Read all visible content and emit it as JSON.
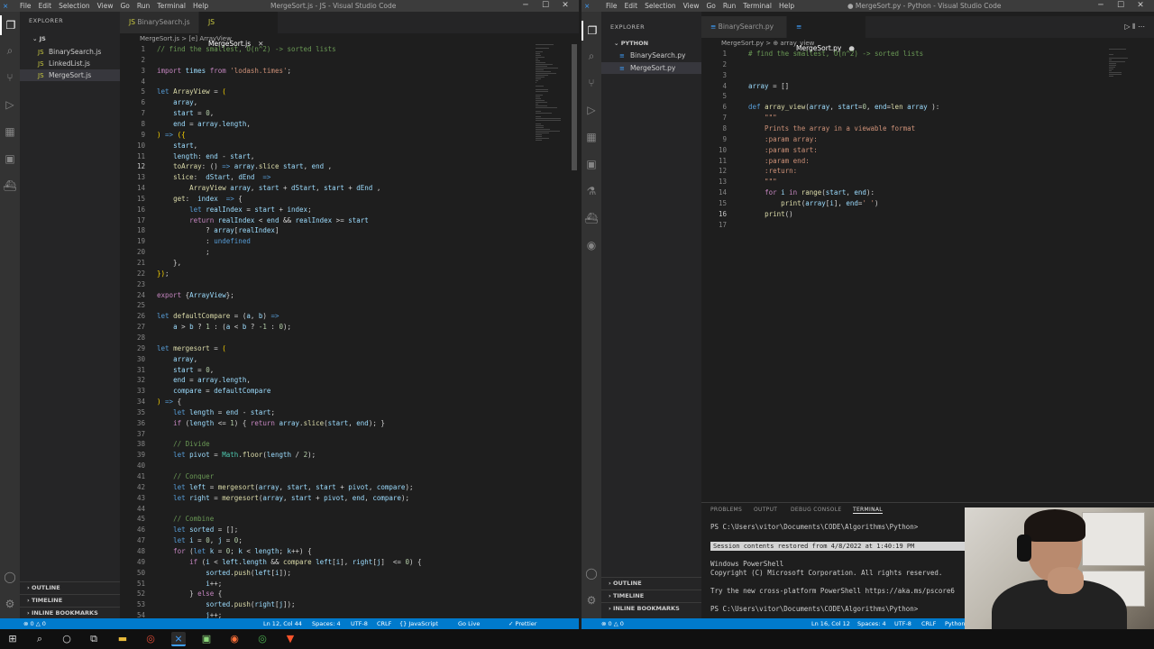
{
  "left": {
    "title": "MergeSort.js - JS - Visual Studio Code",
    "menu": [
      "File",
      "Edit",
      "Selection",
      "View",
      "Go",
      "Run",
      "Terminal",
      "Help"
    ],
    "explorer_label": "EXPLORER",
    "folder": "JS",
    "files": [
      "BinarySearch.js",
      "LinkedList.js",
      "MergeSort.js"
    ],
    "tabs": [
      "BinarySearch.js",
      "MergeSort.js"
    ],
    "breadcrumb": "MergeSort.js > [e] ArrayView",
    "panels": [
      "OUTLINE",
      "TIMELINE",
      "INLINE BOOKMARKS"
    ],
    "status": {
      "errors": "⊗ 0 △ 0",
      "position": "Ln 12, Col 44",
      "spaces": "Spaces: 4",
      "encoding": "UTF-8",
      "eol": "CRLF",
      "language": "{} JavaScript",
      "golive": "Go Live",
      "prettier": "✓ Prettier"
    },
    "lines": [
      {
        "n": "1",
        "h": "<span class='cm'>// find the smallest, O(n^2) -> sorted lists</span>"
      },
      {
        "n": "2",
        "h": ""
      },
      {
        "n": "3",
        "h": "<span class='kw2'>import</span> <span class='vr'>times</span> <span class='kw2'>from</span> <span class='st'>'lodash.times'</span>;"
      },
      {
        "n": "4",
        "h": ""
      },
      {
        "n": "5",
        "h": "<span class='kw'>let</span> <span class='fn'>ArrayView</span> = <span class='br'>(</span>"
      },
      {
        "n": "6",
        "h": "    <span class='vr'>array</span>,"
      },
      {
        "n": "7",
        "h": "    <span class='vr'>start</span> = <span class='nu'>0</span>,"
      },
      {
        "n": "8",
        "h": "    <span class='vr'>end</span> = <span class='vr'>array</span>.<span class='vr'>length</span>,"
      },
      {
        "n": "9",
        "h": "<span class='br'>)</span> <span class='kw'>=></span> <span class='br'>({</span>"
      },
      {
        "n": "10",
        "h": "    <span class='vr'>start</span>,"
      },
      {
        "n": "11",
        "h": "    <span class='vr'>length</span>: <span class='vr'>end</span> - <span class='vr'>start</span>,"
      },
      {
        "n": "12",
        "h": "    <span class='fn'>toArray</span>: () <span class='kw'>=></span> <span class='vr'>array</span>.<span class='fn'>slice</span> <span class='vr'>start</span>, <span class='vr'>end</span> ,"
      },
      {
        "n": "13",
        "h": "    <span class='fn'>slice</span>:  <span class='vr'>dStart</span>, <span class='vr'>dEnd</span>  <span class='kw'>=></span>"
      },
      {
        "n": "14",
        "h": "        <span class='fn'>ArrayView</span> <span class='vr'>array</span>, <span class='vr'>start</span> + <span class='vr'>dStart</span>, <span class='vr'>start</span> + <span class='vr'>dEnd</span> ,"
      },
      {
        "n": "15",
        "h": "    <span class='fn'>get</span>:  <span class='vr'>index</span>  <span class='kw'>=></span> {"
      },
      {
        "n": "16",
        "h": "        <span class='kw'>let</span> <span class='vr'>realIndex</span> = <span class='vr'>start</span> + <span class='vr'>index</span>;"
      },
      {
        "n": "17",
        "h": "        <span class='kw2'>return</span> <span class='vr'>realIndex</span> < <span class='vr'>end</span> && <span class='vr'>realIndex</span> >= <span class='vr'>start</span>"
      },
      {
        "n": "18",
        "h": "            ? <span class='vr'>array</span>[<span class='vr'>realIndex</span>]"
      },
      {
        "n": "19",
        "h": "            : <span class='kw'>undefined</span>"
      },
      {
        "n": "20",
        "h": "            ;"
      },
      {
        "n": "21",
        "h": "    },"
      },
      {
        "n": "22",
        "h": "<span class='br'>})</span>;"
      },
      {
        "n": "23",
        "h": ""
      },
      {
        "n": "24",
        "h": "<span class='kw2'>export</span> {<span class='vr'>ArrayView</span>};"
      },
      {
        "n": "25",
        "h": ""
      },
      {
        "n": "26",
        "h": "<span class='kw'>let</span> <span class='fn'>defaultCompare</span> = (<span class='vr'>a</span>, <span class='vr'>b</span>) <span class='kw'>=></span>"
      },
      {
        "n": "27",
        "h": "    <span class='vr'>a</span> > <span class='vr'>b</span> ? <span class='nu'>1</span> : (<span class='vr'>a</span> < <span class='vr'>b</span> ? <span class='nu'>-1</span> : <span class='nu'>0</span>);"
      },
      {
        "n": "28",
        "h": ""
      },
      {
        "n": "29",
        "h": "<span class='kw'>let</span> <span class='fn'>mergesort</span> = <span class='br'>(</span>"
      },
      {
        "n": "30",
        "h": "    <span class='vr'>array</span>,"
      },
      {
        "n": "31",
        "h": "    <span class='vr'>start</span> = <span class='nu'>0</span>,"
      },
      {
        "n": "32",
        "h": "    <span class='vr'>end</span> = <span class='vr'>array</span>.<span class='vr'>length</span>,"
      },
      {
        "n": "33",
        "h": "    <span class='vr'>compare</span> = <span class='vr'>defaultCompare</span>"
      },
      {
        "n": "34",
        "h": "<span class='br'>)</span> <span class='kw'>=></span> {"
      },
      {
        "n": "35",
        "h": "    <span class='kw'>let</span> <span class='vr'>length</span> = <span class='vr'>end</span> - <span class='vr'>start</span>;"
      },
      {
        "n": "36",
        "h": "    <span class='kw2'>if</span> (<span class='vr'>length</span> <= <span class='nu'>1</span>) { <span class='kw2'>return</span> <span class='vr'>array</span>.<span class='fn'>slice</span>(<span class='vr'>start</span>, <span class='vr'>end</span>); }"
      },
      {
        "n": "37",
        "h": ""
      },
      {
        "n": "38",
        "h": "    <span class='cm'>// Divide</span>"
      },
      {
        "n": "39",
        "h": "    <span class='kw'>let</span> <span class='vr'>pivot</span> = <span class='ty'>Math</span>.<span class='fn'>floor</span>(<span class='vr'>length</span> / <span class='nu'>2</span>);"
      },
      {
        "n": "40",
        "h": ""
      },
      {
        "n": "41",
        "h": "    <span class='cm'>// Conquer</span>"
      },
      {
        "n": "42",
        "h": "    <span class='kw'>let</span> <span class='vr'>left</span> = <span class='fn'>mergesort</span>(<span class='vr'>array</span>, <span class='vr'>start</span>, <span class='vr'>start</span> + <span class='vr'>pivot</span>, <span class='vr'>compare</span>);"
      },
      {
        "n": "43",
        "h": "    <span class='kw'>let</span> <span class='vr'>right</span> = <span class='fn'>mergesort</span>(<span class='vr'>array</span>, <span class='vr'>start</span> + <span class='vr'>pivot</span>, <span class='vr'>end</span>, <span class='vr'>compare</span>);"
      },
      {
        "n": "44",
        "h": ""
      },
      {
        "n": "45",
        "h": "    <span class='cm'>// Combine</span>"
      },
      {
        "n": "46",
        "h": "    <span class='kw'>let</span> <span class='vr'>sorted</span> = [];"
      },
      {
        "n": "47",
        "h": "    <span class='kw'>let</span> <span class='vr'>i</span> = <span class='nu'>0</span>, <span class='vr'>j</span> = <span class='nu'>0</span>;"
      },
      {
        "n": "48",
        "h": "    <span class='kw2'>for</span> (<span class='kw'>let</span> <span class='vr'>k</span> = <span class='nu'>0</span>; <span class='vr'>k</span> < <span class='vr'>length</span>; <span class='vr'>k</span>++) {"
      },
      {
        "n": "49",
        "h": "        <span class='kw2'>if</span> (<span class='vr'>i</span> < <span class='vr'>left</span>.<span class='vr'>length</span> && <span class='fn'>compare</span> <span class='vr'>left</span>[<span class='vr'>i</span>], <span class='vr'>right</span>[<span class='vr'>j</span>]  <= <span class='nu'>0</span>) {"
      },
      {
        "n": "50",
        "h": "            <span class='vr'>sorted</span>.<span class='fn'>push</span>(<span class='vr'>left</span>[<span class='vr'>i</span>]);"
      },
      {
        "n": "51",
        "h": "            <span class='vr'>i</span>++;"
      },
      {
        "n": "52",
        "h": "        } <span class='kw2'>else</span> {"
      },
      {
        "n": "53",
        "h": "            <span class='vr'>sorted</span>.<span class='fn'>push</span>(<span class='vr'>right</span>[<span class='vr'>j</span>]);"
      },
      {
        "n": "54",
        "h": "            <span class='vr'>j</span>++;"
      }
    ]
  },
  "right": {
    "title": "● MergeSort.py - Python - Visual Studio Code",
    "menu": [
      "File",
      "Edit",
      "Selection",
      "View",
      "Go",
      "Run",
      "Terminal",
      "Help"
    ],
    "explorer_label": "EXPLORER",
    "folder": "PYTHON",
    "files": [
      "BinarySearch.py",
      "MergeSort.py"
    ],
    "tabs": [
      "BinarySearch.py",
      "MergeSort.py"
    ],
    "breadcrumb": "MergeSort.py > ⊕ array_view",
    "panels": [
      "OUTLINE",
      "TIMELINE",
      "INLINE BOOKMARKS"
    ],
    "terminal": {
      "tabs": [
        "PROBLEMS",
        "OUTPUT",
        "DEBUG CONSOLE",
        "TERMINAL"
      ],
      "prompt1": "PS C:\\Users\\vitor\\Documents\\CODE\\Algorithms\\Python>",
      "banner": "Session contents restored from 4/8/2022 at 1:40:19 PM",
      "l1": "Windows PowerShell",
      "l2": "Copyright (C) Microsoft Corporation. All rights reserved.",
      "l3": "Try the new cross-platform PowerShell https://aka.ms/pscore6",
      "prompt2": "PS C:\\Users\\vitor\\Documents\\CODE\\Algorithms\\Python>"
    },
    "status": {
      "errors": "⊗ 0 △ 0",
      "position": "Ln 16, Col 12",
      "spaces": "Spaces: 4",
      "encoding": "UTF-8",
      "eol": "CRLF",
      "language": "Python"
    },
    "lines": [
      {
        "n": "1",
        "h": "<span class='cm'># find the smallest, O(n^2) -> sorted lists</span>"
      },
      {
        "n": "2",
        "h": ""
      },
      {
        "n": "3",
        "h": ""
      },
      {
        "n": "4",
        "h": "<span class='vr'>array</span> = []"
      },
      {
        "n": "5",
        "h": ""
      },
      {
        "n": "6",
        "h": "<span class='kw'>def</span> <span class='fn'>array_view</span>(<span class='vr'>array</span>, <span class='vr'>start</span>=<span class='nu'>0</span>, <span class='vr'>end</span>=<span class='fn'>len</span> <span class='vr'>array</span> ):"
      },
      {
        "n": "7",
        "h": "    <span class='st'>\"\"\"</span>"
      },
      {
        "n": "8",
        "h": "<span class='st'>    Prints the array in a viewable format</span>"
      },
      {
        "n": "9",
        "h": "<span class='st'>    :param array:</span>"
      },
      {
        "n": "10",
        "h": "<span class='st'>    :param start:</span>"
      },
      {
        "n": "11",
        "h": "<span class='st'>    :param end:</span>"
      },
      {
        "n": "12",
        "h": "<span class='st'>    :return:</span>"
      },
      {
        "n": "13",
        "h": "<span class='st'>    \"\"\"</span>"
      },
      {
        "n": "14",
        "h": "    <span class='kw2'>for</span> <span class='vr'>i</span> <span class='kw2'>in</span> <span class='fn'>range</span>(<span class='vr'>start</span>, <span class='vr'>end</span>):"
      },
      {
        "n": "15",
        "h": "        <span class='fn'>print</span>(<span class='vr'>array</span>[<span class='vr'>i</span>], <span class='vr'>end</span>=<span class='st'>' '</span>)"
      },
      {
        "n": "16",
        "h": "    <span class='fn'>print</span>()"
      },
      {
        "n": "17",
        "h": ""
      }
    ]
  },
  "icons": {
    "activity": [
      "files-icon",
      "search-icon",
      "source-control-icon",
      "run-debug-icon",
      "extensions-icon",
      "remote-icon",
      "docker-icon",
      "account-icon",
      "settings-icon"
    ],
    "taskbar": [
      "windows-start-icon",
      "search-icon",
      "cortana-icon",
      "task-view-icon",
      "file-explorer-icon",
      "chrome-canary-icon",
      "vscode-icon",
      "terminal-icon",
      "firefox-icon",
      "chrome-icon",
      "brave-icon"
    ]
  }
}
